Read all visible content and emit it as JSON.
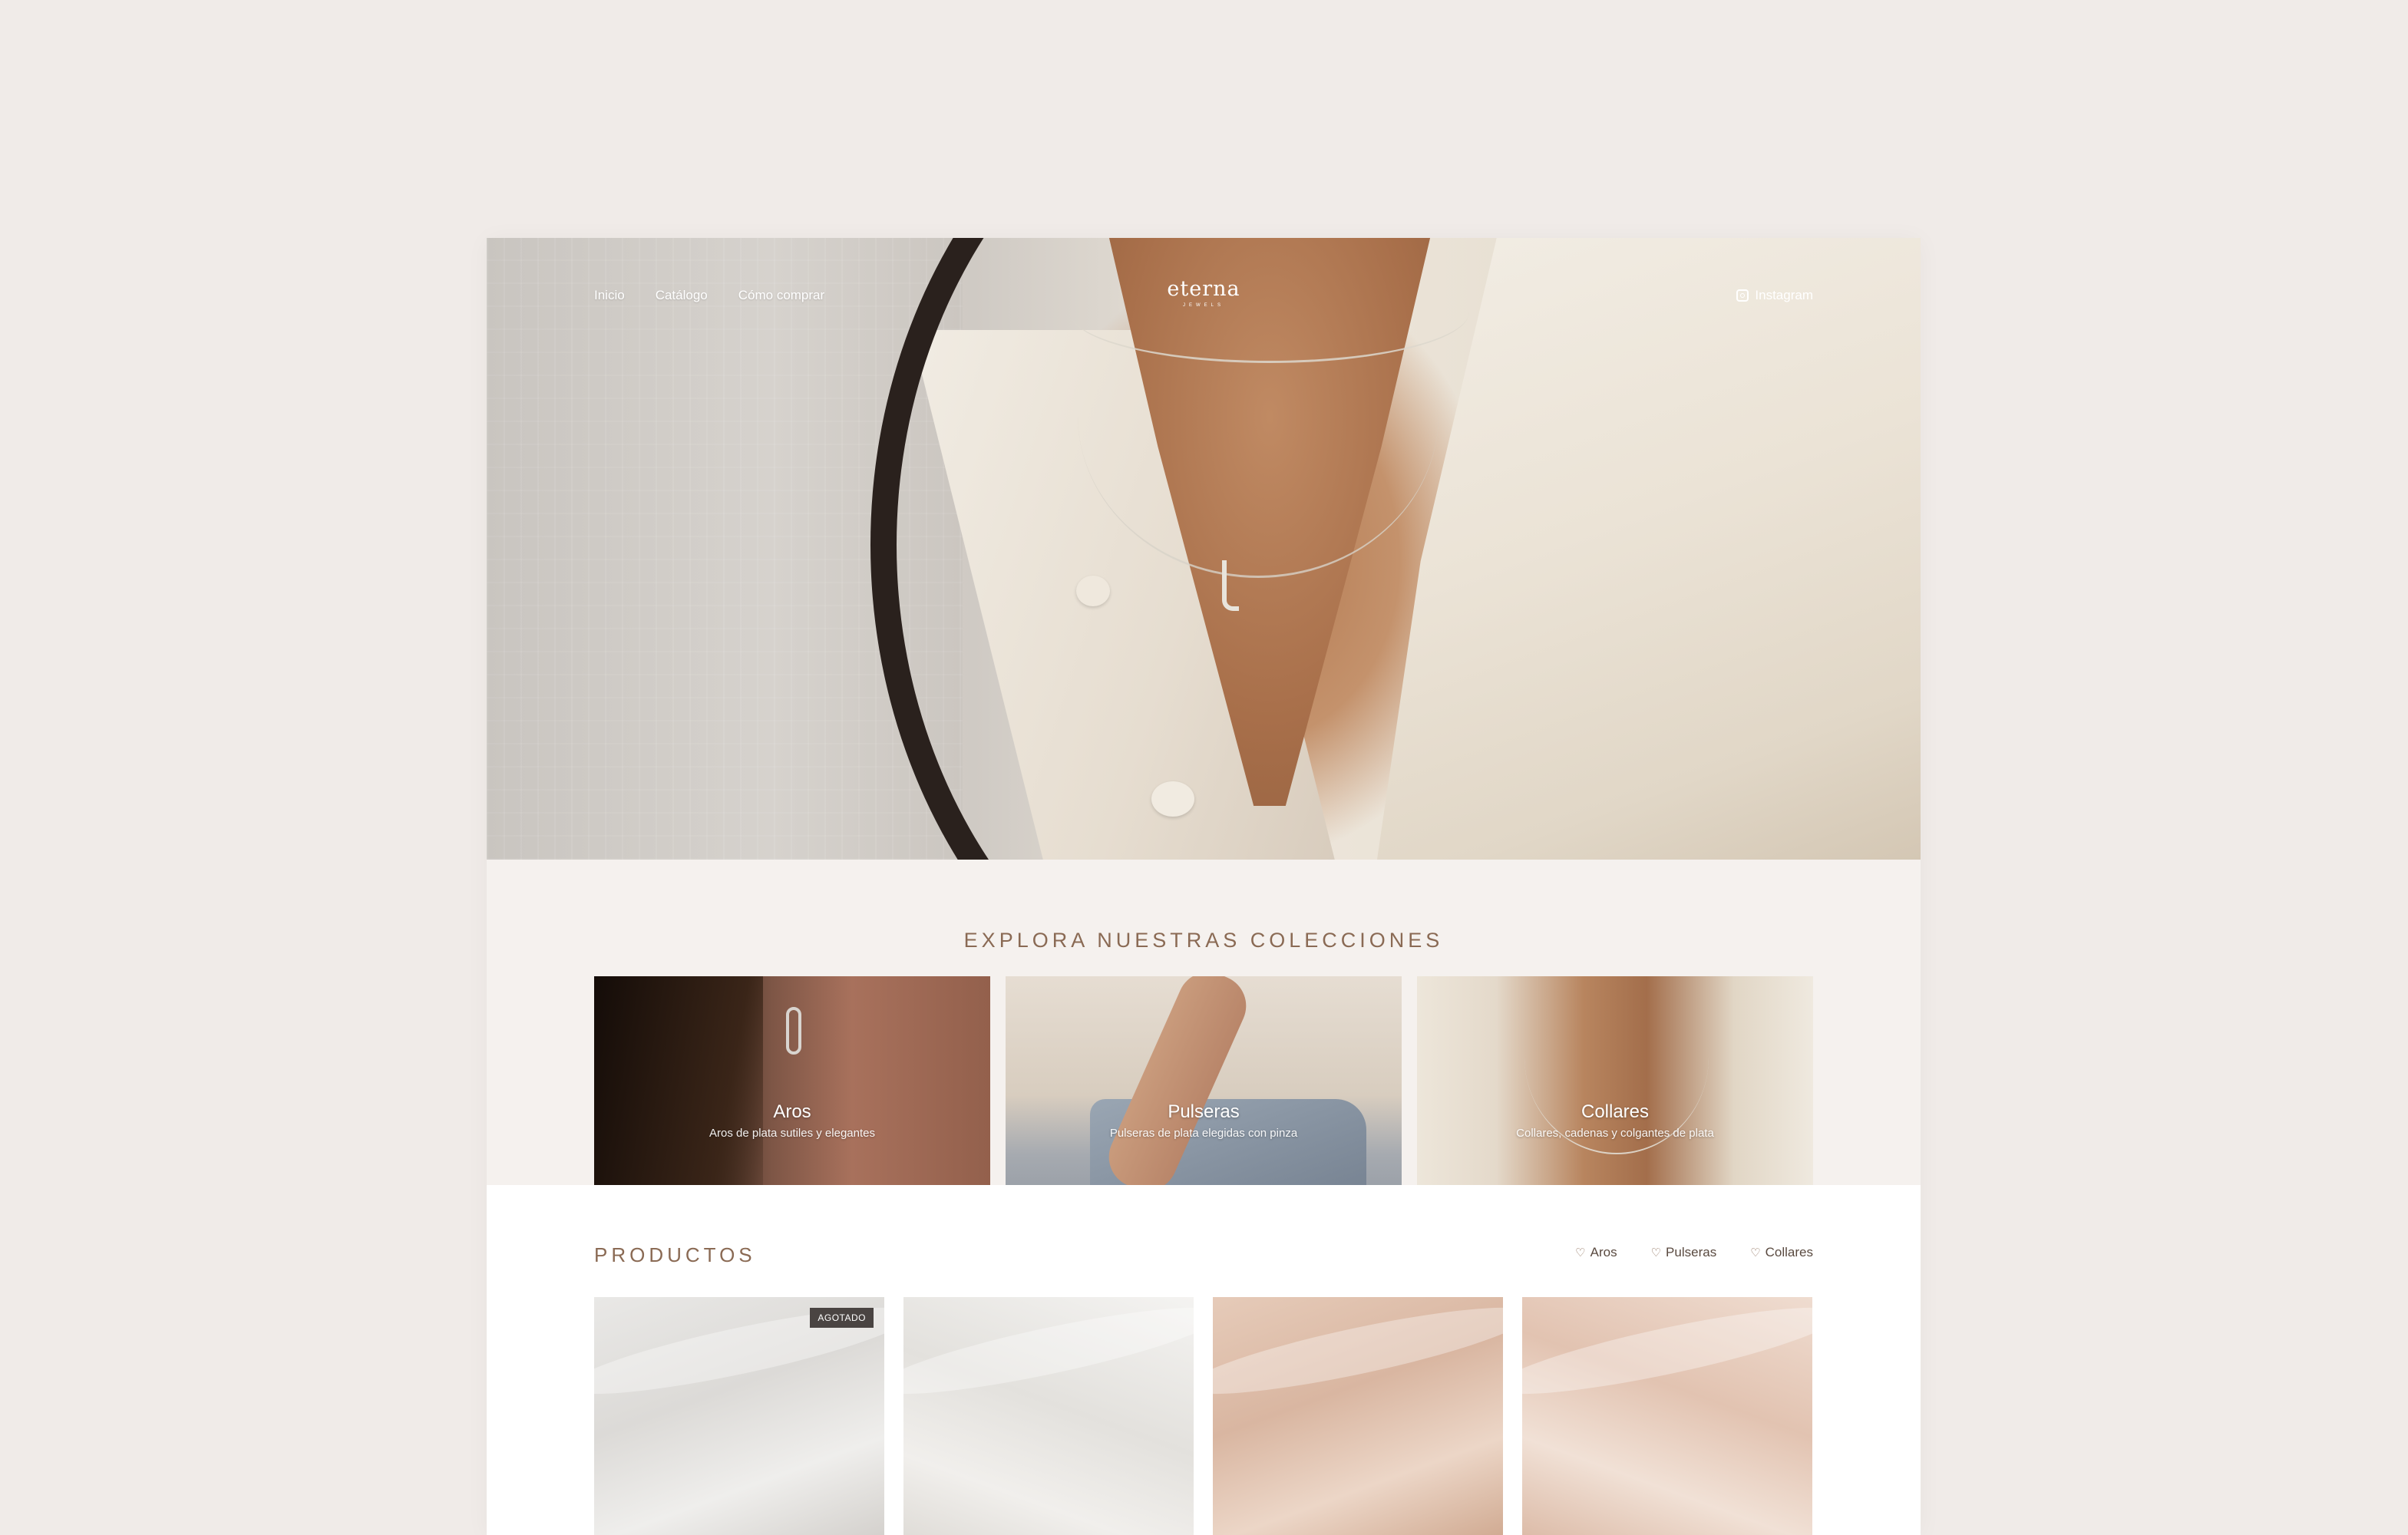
{
  "nav": {
    "links": [
      "Inicio",
      "Catálogo",
      "Cómo comprar"
    ],
    "logo_main": "eterna",
    "logo_sub": "JEWELS",
    "instagram_label": "Instagram"
  },
  "collections": {
    "title": "EXPLORA NUESTRAS COLECCIONES",
    "items": [
      {
        "name": "Aros",
        "description": "Aros de plata sutiles y elegantes"
      },
      {
        "name": "Pulseras",
        "description": "Pulseras de plata elegidas con pinza"
      },
      {
        "name": "Collares",
        "description": "Collares, cadenas y colgantes de plata"
      }
    ]
  },
  "products": {
    "title": "PRODUCTOS",
    "filters": [
      "Aros",
      "Pulseras",
      "Collares"
    ],
    "badge_sold_out": "AGOTADO"
  },
  "colors": {
    "page_bg": "#f0ebe8",
    "section_bg": "#f5f1ee",
    "accent_text": "#8a6a54",
    "badge_bg": "#4a4442"
  }
}
